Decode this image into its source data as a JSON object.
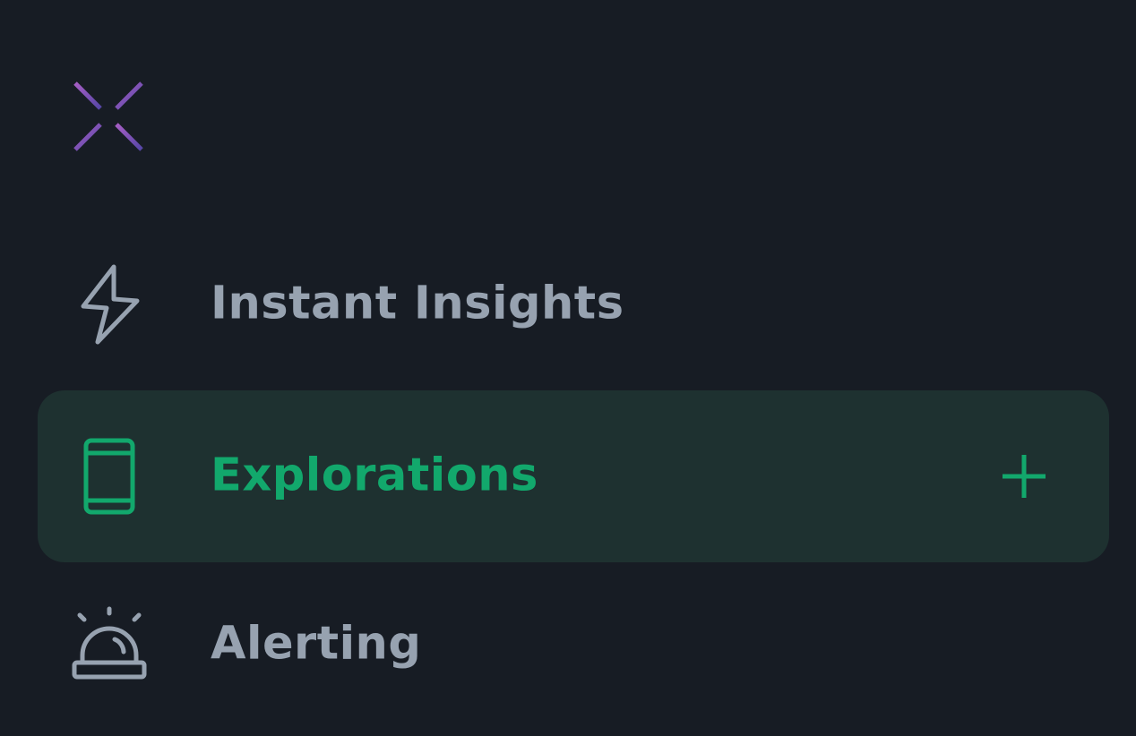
{
  "app": {
    "logo_icon": "sparkle-logo-icon"
  },
  "nav": {
    "items": [
      {
        "label": "Instant Insights",
        "icon": "lightning-bolt-icon",
        "active": false
      },
      {
        "label": "Explorations",
        "icon": "mobile-device-icon",
        "active": true,
        "action_icon": "plus-icon"
      },
      {
        "label": "Alerting",
        "icon": "siren-bell-icon",
        "active": false
      }
    ]
  },
  "colors": {
    "background": "#171c24",
    "active_background": "#1e3130",
    "accent": "#12a86c",
    "muted_text": "#97a2b0",
    "logo_gradient_start": "#a05cc0",
    "logo_gradient_end": "#5a48a8"
  }
}
